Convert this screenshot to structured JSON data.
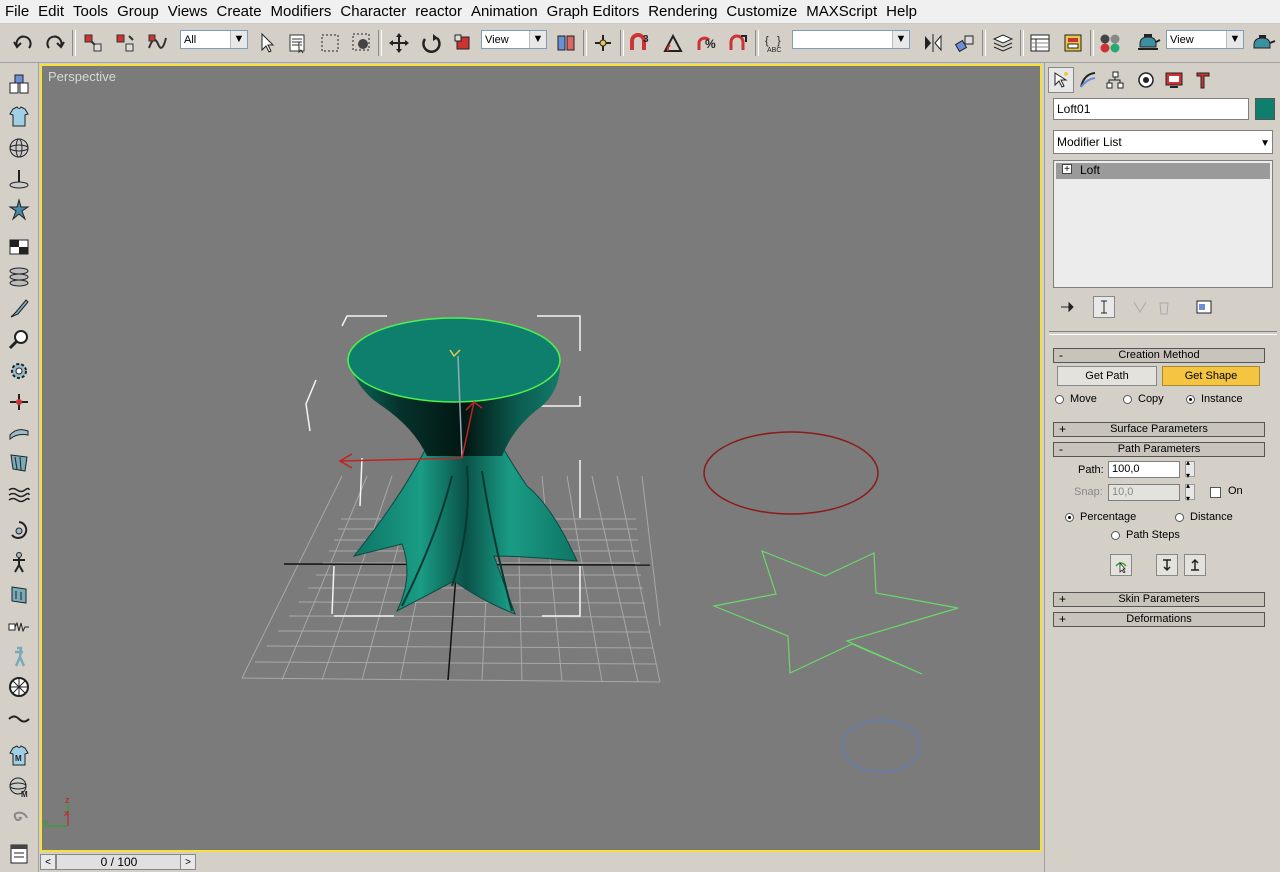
{
  "menu": [
    "File",
    "Edit",
    "Tools",
    "Group",
    "Views",
    "Create",
    "Modifiers",
    "Character",
    "reactor",
    "Animation",
    "Graph Editors",
    "Rendering",
    "Customize",
    "MAXScript",
    "Help"
  ],
  "toolbar": {
    "selection_filter": "All",
    "reference_coord": "View",
    "named_selection": "",
    "render_view": "View"
  },
  "viewport": {
    "label": "Perspective",
    "axis_z": "z",
    "axis_y": "y",
    "axis_x": "x"
  },
  "timeline": {
    "frame_label": "0 / 100",
    "prev": "<",
    "next": ">"
  },
  "command_panel": {
    "object_name": "Loft01",
    "object_color": "#0e7f6d",
    "modifier_list_label": "Modifier List",
    "stack_items": [
      {
        "label": "Loft",
        "expand": "+"
      }
    ],
    "rollouts": {
      "creation_method": {
        "title": "Creation Method",
        "toggle": "-",
        "get_path": "Get Path",
        "get_shape": "Get Shape",
        "options": [
          {
            "label": "Move",
            "checked": false
          },
          {
            "label": "Copy",
            "checked": false
          },
          {
            "label": "Instance",
            "checked": true
          }
        ]
      },
      "surface_parameters": {
        "title": "Surface Parameters",
        "toggle": "+"
      },
      "path_parameters": {
        "title": "Path Parameters",
        "toggle": "-",
        "path_label": "Path:",
        "path_value": "100,0",
        "snap_label": "Snap:",
        "snap_value": "10,0",
        "on_label": "On",
        "percentage": "Percentage",
        "distance": "Distance",
        "path_steps": "Path Steps"
      },
      "skin_parameters": {
        "title": "Skin Parameters",
        "toggle": "+"
      },
      "deformations": {
        "title": "Deformations",
        "toggle": "+"
      }
    }
  },
  "colors": {
    "viewport_bg": "#7b7b7b",
    "active_border": "#f3e13a",
    "loft_teal": "#0e7f6d",
    "ellipse_red": "#8b1a1a",
    "star_green": "#6ad96a",
    "circle_blue": "#5b7fbf"
  }
}
